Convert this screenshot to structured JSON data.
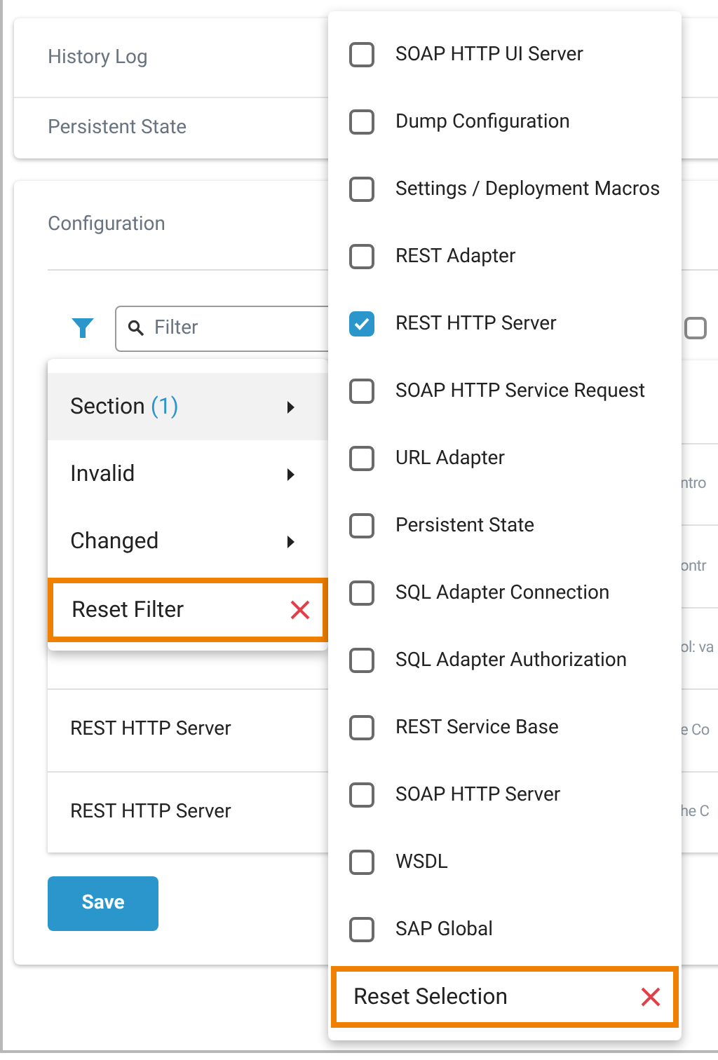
{
  "cards": [
    {
      "label": "History Log"
    },
    {
      "label": "Persistent State"
    }
  ],
  "configuration": {
    "title": "Configuration",
    "filter": {
      "placeholder": "Filter"
    },
    "select_all": {
      "checked": false
    },
    "rows": [
      {},
      {
        "column_2": "ntro"
      },
      {
        "column_2": "ontr"
      },
      {
        "column_2": "ol: va"
      },
      {
        "column_1": "REST HTTP Server",
        "column_2": "e Co"
      },
      {
        "column_1": "REST HTTP Server",
        "column_2": "he C"
      }
    ],
    "save_button": "Save"
  },
  "filter_menu": {
    "items": [
      {
        "kind": "submenu",
        "label": "Section",
        "count": "(1)",
        "selected": true
      },
      {
        "kind": "submenu",
        "label": "Invalid",
        "selected": false
      },
      {
        "kind": "submenu",
        "label": "Changed",
        "selected": false
      },
      {
        "kind": "reset",
        "label": "Reset Filter"
      }
    ]
  },
  "section_menu": {
    "items": [
      {
        "label": "SOAP HTTP UI Server",
        "checked": false
      },
      {
        "label": "Dump Configuration",
        "checked": false
      },
      {
        "label": "Settings / Deployment Macros",
        "checked": false
      },
      {
        "label": "REST Adapter",
        "checked": false
      },
      {
        "label": "REST HTTP Server",
        "checked": true
      },
      {
        "label": "SOAP HTTP Service Request",
        "checked": false
      },
      {
        "label": "URL Adapter",
        "checked": false
      },
      {
        "label": "Persistent State",
        "checked": false
      },
      {
        "label": "SQL Adapter Connection",
        "checked": false
      },
      {
        "label": "SQL Adapter Authorization",
        "checked": false
      },
      {
        "label": "REST Service Base",
        "checked": false
      },
      {
        "label": "SOAP HTTP Server",
        "checked": false
      },
      {
        "label": "WSDL",
        "checked": false
      },
      {
        "label": "SAP Global",
        "checked": false
      }
    ],
    "reset": {
      "label": "Reset Selection"
    }
  }
}
